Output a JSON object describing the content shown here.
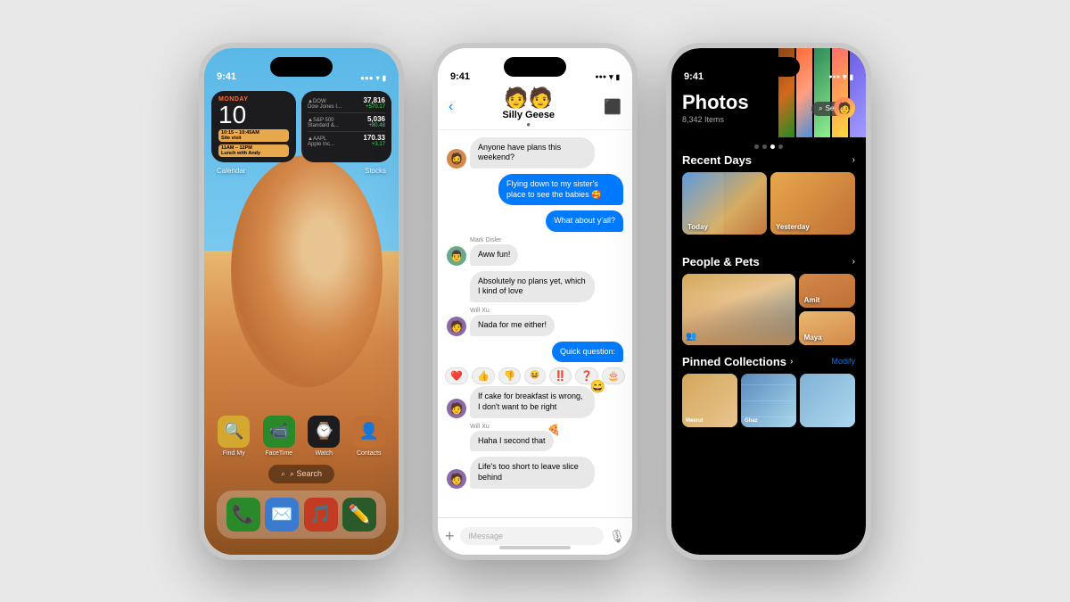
{
  "page": {
    "background": "#e8e8e8"
  },
  "phone1": {
    "status": {
      "time": "9:41",
      "signal": "●●●",
      "wifi": "wifi",
      "battery": "battery"
    },
    "widget_calendar": {
      "day": "MONDAY",
      "date": "10",
      "event1_time": "10:15 – 10:45AM",
      "event1_title": "Site visit",
      "event2_time": "11AM – 12PM",
      "event2_title": "Lunch with Andy"
    },
    "widget_stocks": {
      "item1_name": "▲DOW",
      "item1_sub": "Dow Jones I...",
      "item1_price": "37,816",
      "item1_change": "+570.17",
      "item2_name": "▲S&P 500",
      "item2_sub": "Standard &...",
      "item2_price": "5,036",
      "item2_change": "+80.48",
      "item3_name": "▲AAPL",
      "item3_sub": "Apple Inc...",
      "item3_price": "170.33",
      "item3_change": "+3.17"
    },
    "widget_labels": {
      "calendar": "Calendar",
      "stocks": "Stocks"
    },
    "search": "⌕ Search",
    "apps": [
      {
        "name": "Find My",
        "emoji": "🟡",
        "bg": "#1c1c1e"
      },
      {
        "name": "FaceTime",
        "emoji": "📹",
        "bg": "#3a7a3a"
      },
      {
        "name": "Watch",
        "emoji": "⌚",
        "bg": "#1c1c1e"
      },
      {
        "name": "Contacts",
        "emoji": "👤",
        "bg": "#d4884a"
      }
    ],
    "dock": [
      "📞",
      "✉️",
      "🎵",
      "✏️"
    ]
  },
  "phone2": {
    "status": {
      "time": "9:41"
    },
    "messages": {
      "group_name": "Silly Geese",
      "group_emoji": "🧑‍🤝‍🧑",
      "messages": [
        {
          "sender": "",
          "type": "received",
          "avatar": "🧔",
          "text": "Anyone have plans this weekend?"
        },
        {
          "sender": "",
          "type": "sent",
          "text": "Flying down to my sister's place to see the babies 🥰"
        },
        {
          "sender": "",
          "type": "sent",
          "text": "What about y'all?"
        },
        {
          "sender": "Mark Disler",
          "type": "received",
          "avatar": "👨",
          "text": "Aww fun!"
        },
        {
          "sender": "",
          "type": "received",
          "avatar": "",
          "text": "Absolutely no plans yet, which I kind of love"
        },
        {
          "sender": "Will Xu",
          "type": "received",
          "avatar": "🧑",
          "text": "Nada for me either!"
        },
        {
          "sender": "",
          "type": "sent",
          "text": "Quick question:"
        },
        {
          "sender": "",
          "type": "received",
          "avatar": "🧑",
          "text": "If cake for breakfast is wrong, I don't want to be right"
        },
        {
          "sender": "Will Xu",
          "type": "received",
          "avatar": "",
          "text": "Haha I second that"
        },
        {
          "sender": "",
          "type": "received",
          "avatar": "🧑",
          "text": "Life's too short to leave slice behind"
        }
      ],
      "reactions": [
        "❤️",
        "👍",
        "👎",
        "😆",
        "‼️",
        "❓",
        "🎂"
      ],
      "input_placeholder": "iMessage"
    }
  },
  "phone3": {
    "status": {
      "time": "9:41"
    },
    "photos": {
      "title": "Photos",
      "count": "8,342 Items",
      "search_label": "Search",
      "sections": {
        "recent_days": "Recent Days",
        "people_pets": "People & Pets",
        "pinned": "Pinned Collections",
        "pinned_action": "Modify"
      },
      "recent_labels": [
        "Today",
        "Yesterday"
      ],
      "people": [
        "Amit",
        "Maya"
      ],
      "pinned_items": [
        "Meerut",
        "Ghaz"
      ]
    }
  }
}
